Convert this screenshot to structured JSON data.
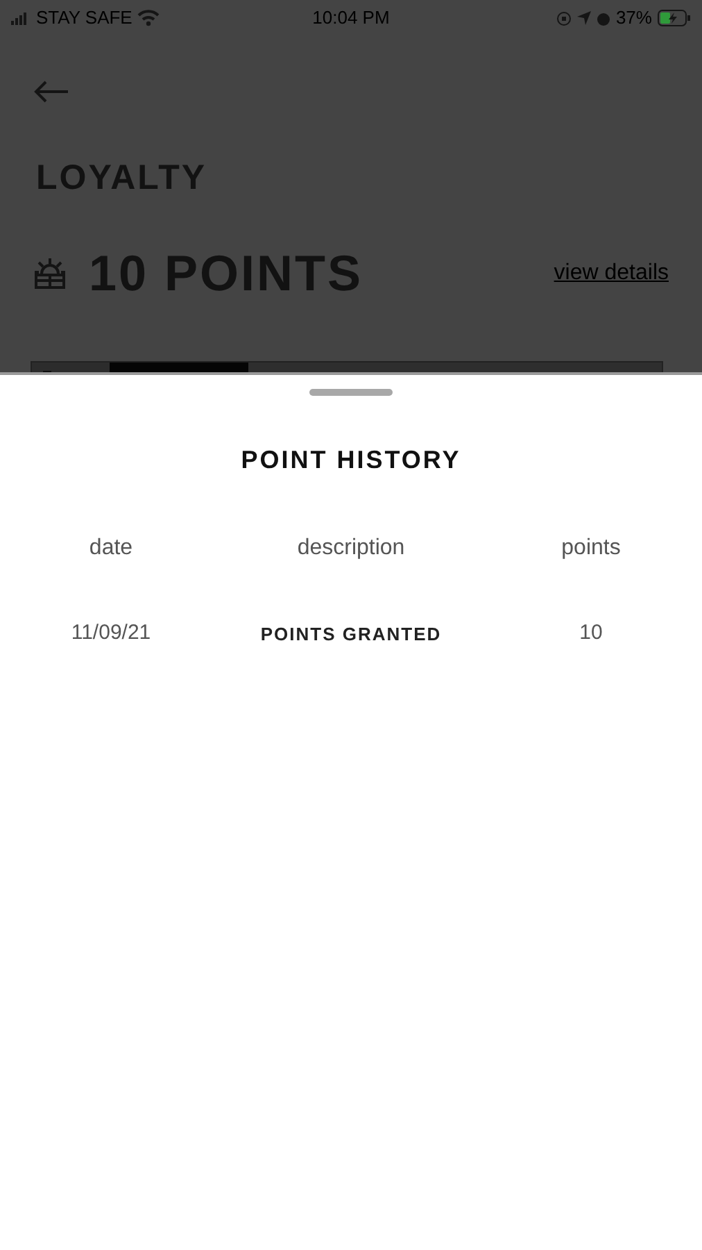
{
  "status_bar": {
    "carrier": "STAY SAFE",
    "time": "10:04 PM",
    "battery": "37%"
  },
  "page": {
    "title": "LOYALTY",
    "points": "10 POINTS",
    "details_link": "view details"
  },
  "sheet": {
    "title": "POINT HISTORY",
    "columns": [
      "date",
      "description",
      "points"
    ],
    "rows": [
      {
        "date": "11/09/21",
        "description": "POINTS GRANTED",
        "points": "10"
      }
    ]
  }
}
